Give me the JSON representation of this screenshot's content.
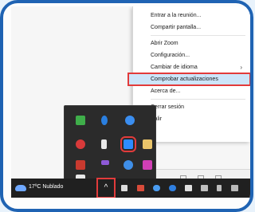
{
  "context_menu": {
    "items": [
      {
        "label": "Entrar a la reunión..."
      },
      {
        "label": "Compartir pantalla..."
      },
      {
        "label": "Abrir Zoom"
      },
      {
        "label": "Configuración..."
      },
      {
        "label": "Cambiar de idioma"
      },
      {
        "label": "Comprobar actualizaciones"
      },
      {
        "label": "Acerca de..."
      },
      {
        "label": "Cerrar sesión"
      },
      {
        "label": "Salir"
      }
    ],
    "highlighted_item": "Comprobar actualizaciones",
    "submenu_indicator": "›"
  },
  "taskbar": {
    "weather_text": "17ºC  Nublado",
    "overflow_chevron": "^"
  },
  "tray_icons": [
    "green-shield-icon",
    "bluetooth-icon",
    "blue-chat-icon",
    "red-record-icon",
    "usb-drive-icon",
    "zoom-icon",
    "folder-app-icon",
    "red-app-icon",
    "purple-app-icon",
    "cloud-sync-icon",
    "colorful-app-icon",
    "office-app-icon"
  ],
  "colors": {
    "highlight_border": "#e23b3b",
    "frame_border": "#1f63b3",
    "taskbar": "#202020",
    "menu_highlight_bg": "#cde5fa"
  }
}
